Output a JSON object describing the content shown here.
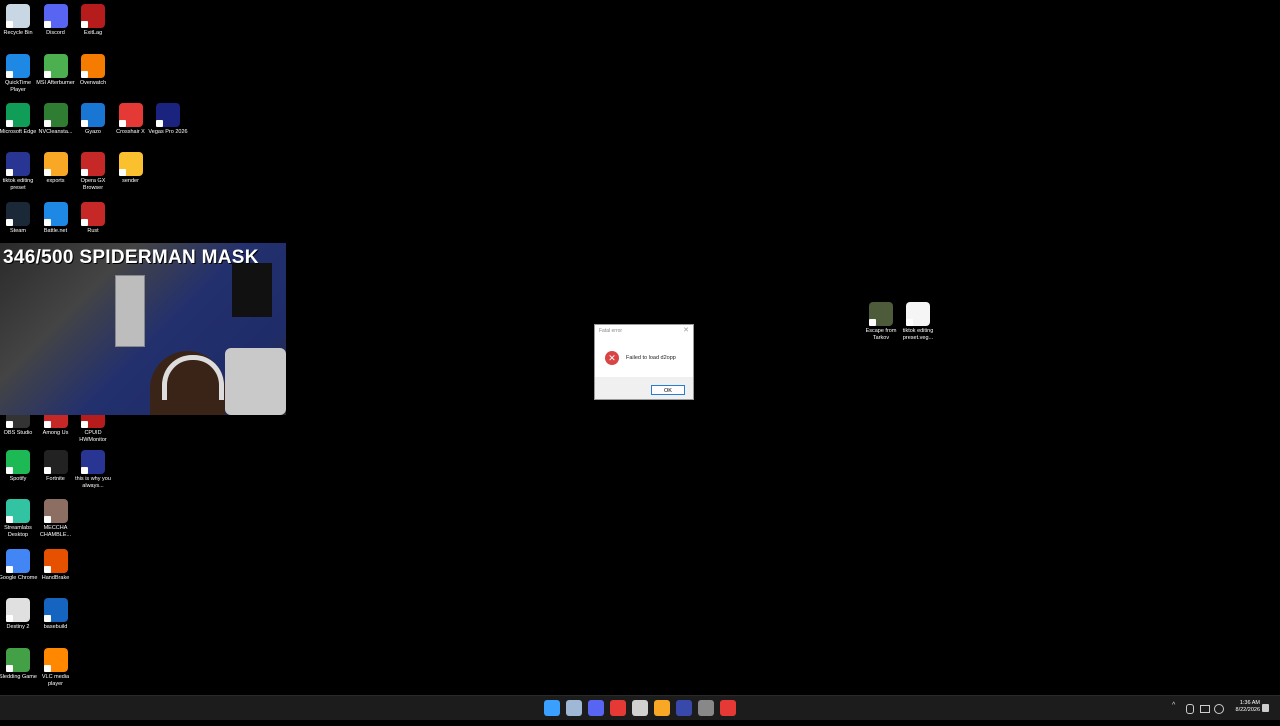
{
  "desktop_icons_top": [
    {
      "label": "Recycle Bin",
      "color": "#c9d6e3"
    },
    {
      "label": "Discord",
      "color": "#5865f2"
    },
    {
      "label": "ExitLag",
      "color": "#b71c1c"
    },
    {
      "label": "QuickTime Player",
      "color": "#1e88e5"
    },
    {
      "label": "MSI Afterburner",
      "color": "#4caf50"
    },
    {
      "label": "Overwatch",
      "color": "#f57c00"
    },
    {
      "label": "Microsoft Edge",
      "color": "#0f9d58"
    },
    {
      "label": "NVCleansta...",
      "color": "#2e7d32"
    },
    {
      "label": "Gyazo",
      "color": "#1976d2"
    },
    {
      "label": "Crosshair X",
      "color": "#e53935"
    },
    {
      "label": "Vegas Pro 2026",
      "color": "#1a237e"
    },
    {
      "label": "tiktok editing preset",
      "color": "#283593"
    },
    {
      "label": "exports",
      "color": "#f9a825"
    },
    {
      "label": "Opera GX Browser",
      "color": "#c62828"
    },
    {
      "label": "sender",
      "color": "#fbc02d"
    },
    {
      "label": "Steam",
      "color": "#1b2838"
    },
    {
      "label": "Battle.net",
      "color": "#1e88e5"
    },
    {
      "label": "Rust",
      "color": "#c62828"
    }
  ],
  "desktop_icons_bottom": [
    {
      "label": "OBS Studio",
      "color": "#333"
    },
    {
      "label": "Among Us",
      "color": "#c62828"
    },
    {
      "label": "CPUID HWMonitor",
      "color": "#b71c1c"
    },
    {
      "label": "Spotify",
      "color": "#1db954"
    },
    {
      "label": "Fortnite",
      "color": "#222"
    },
    {
      "label": "this is why you always...",
      "color": "#283593"
    },
    {
      "label": "Streamlabs Desktop",
      "color": "#31c3a2"
    },
    {
      "label": "MECCHA CHAMBLE...",
      "color": "#8d6e63"
    },
    {
      "label": "Google Chrome",
      "color": "#4285f4"
    },
    {
      "label": "HandBrake",
      "color": "#e65100"
    },
    {
      "label": "Destiny 2",
      "color": "#e0e0e0"
    },
    {
      "label": "basebuild",
      "color": "#1565c0"
    },
    {
      "label": "Sledding Game",
      "color": "#43a047"
    },
    {
      "label": "VLC media player",
      "color": "#ff8800"
    }
  ],
  "desktop_icons_right": [
    {
      "label": "Escape from Tarkov",
      "color": "#4e5b3a"
    },
    {
      "label": "tiktok editing preset.veg...",
      "color": "#f5f5f5"
    }
  ],
  "webcam": {
    "overlay_text": "346/500 SPIDERMAN MASK"
  },
  "dialog": {
    "title": "Fatal error",
    "message": "Failed to load d2opp",
    "ok_label": "OK",
    "close_glyph": "✕",
    "icon_glyph": "✕"
  },
  "taskbar": {
    "apps": [
      {
        "name": "start",
        "color": "#3aa0ff"
      },
      {
        "name": "steam",
        "color": "#9fb8d6"
      },
      {
        "name": "discord",
        "color": "#5865f2"
      },
      {
        "name": "opera-gx",
        "color": "#e53935"
      },
      {
        "name": "chrome",
        "color": "#d0d0d0"
      },
      {
        "name": "file-explorer",
        "color": "#f9a825"
      },
      {
        "name": "vegas",
        "color": "#3949ab"
      },
      {
        "name": "terminal",
        "color": "#888"
      },
      {
        "name": "rust",
        "color": "#e53935"
      }
    ],
    "clock_time": "1:36 AM",
    "clock_date": "8/22/2026",
    "tray_chevron": "^"
  }
}
